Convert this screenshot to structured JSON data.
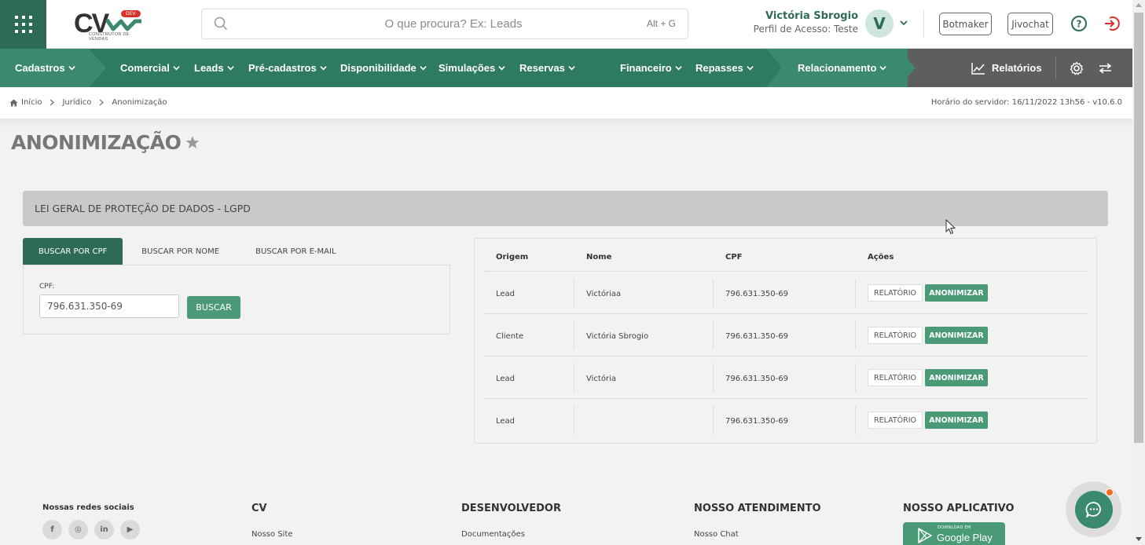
{
  "header": {
    "logo": {
      "text": "CV",
      "badge": "DEV",
      "subtitle": "CONSTRUTOR DE VENDAS"
    },
    "search": {
      "placeholder": "O que procura? Ex: Leads",
      "shortcut": "Alt + G"
    },
    "user": {
      "name": "Victória Sbrogio",
      "profile": "Perfil de Acesso: Teste",
      "initial": "V"
    },
    "buttons": {
      "botmaker": "Botmaker",
      "jivochat": "Jivochat"
    },
    "icons": [
      "apps-grid-icon",
      "search-icon",
      "chevron-down-icon",
      "help-icon",
      "logout-icon"
    ]
  },
  "nav": {
    "items": [
      {
        "label": "Cadastros"
      },
      {
        "label": "Comercial"
      },
      {
        "label": "Leads"
      },
      {
        "label": "Pré-cadastros"
      },
      {
        "label": "Disponibilidade"
      },
      {
        "label": "Simulações"
      },
      {
        "label": "Reservas"
      },
      {
        "label": "Financeiro"
      },
      {
        "label": "Repasses"
      },
      {
        "label": "Relacionamento"
      }
    ],
    "reports": "Relatórios",
    "colors": {
      "primary": "#3b8a6e",
      "dark": "#2e6b57",
      "gray": "#5e5e5e"
    }
  },
  "breadcrumb": {
    "items": [
      "Início",
      "Jurídico",
      "Anonimização"
    ],
    "server_time": "Horário do servidor: 16/11/2022 13h56 - v10.6.0"
  },
  "page": {
    "title": "ANONIMIZAÇÃO",
    "panel_title": "LEI GERAL DE PROTEÇÃO DE DADOS - LGPD"
  },
  "search_form": {
    "tabs": [
      "BUSCAR POR CPF",
      "BUSCAR POR NOME",
      "BUSCAR POR E-MAIL"
    ],
    "active_tab": "BUSCAR POR CPF",
    "cpf_label": "CPF:",
    "cpf_value": "796.631.350-69",
    "submit_label": "BUSCAR"
  },
  "results": {
    "columns": [
      "Origem",
      "Nome",
      "CPF",
      "Ações"
    ],
    "rows": [
      {
        "origem": "Lead",
        "nome": "Victóriaa",
        "cpf": "796.631.350-69"
      },
      {
        "origem": "Cliente",
        "nome": "Victória Sbrogio",
        "cpf": "796.631.350-69"
      },
      {
        "origem": "Lead",
        "nome": "Victória",
        "cpf": "796.631.350-69"
      },
      {
        "origem": "Lead",
        "nome": "",
        "cpf": "796.631.350-69"
      }
    ],
    "action_report": "RELATÓRIO",
    "action_anonymize": "ANONIMIZAR"
  },
  "footer": {
    "social_title": "Nossas redes sociais",
    "social_icons": [
      "facebook-icon",
      "instagram-icon",
      "linkedin-icon",
      "youtube-icon"
    ],
    "social_glyphs": [
      "f",
      "◎",
      "in",
      "▶"
    ],
    "columns": [
      {
        "title": "CV",
        "link": "Nosso Site"
      },
      {
        "title": "DESENVOLVEDOR",
        "link": "Documentações"
      },
      {
        "title": "NOSSO ATENDIMENTO",
        "link": "Nosso Chat"
      },
      {
        "title": "NOSSO APLICATIVO",
        "link": ""
      }
    ],
    "google_play": {
      "small": "DOWNLOAD EM",
      "big": "Google Play"
    }
  }
}
